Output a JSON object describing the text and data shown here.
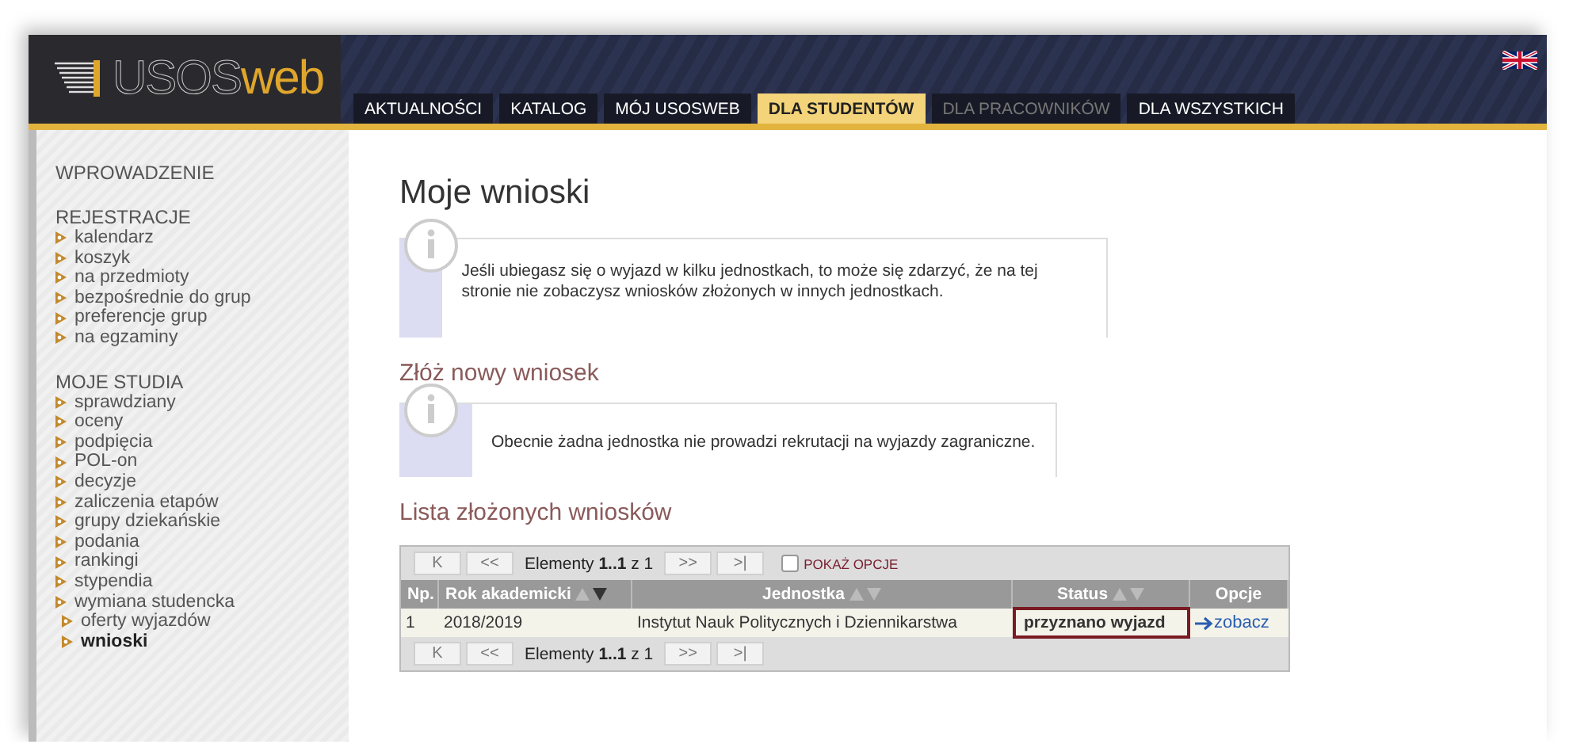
{
  "header": {
    "logo": {
      "part_1": "USOS",
      "part_2": "web"
    },
    "tabs": [
      {
        "label": "AKTUALNOŚCI",
        "selected": false,
        "disabled": false
      },
      {
        "label": "KATALOG",
        "selected": false,
        "disabled": false
      },
      {
        "label": "MÓJ USOSWEB",
        "selected": false,
        "disabled": false
      },
      {
        "label": "DLA STUDENTÓW",
        "selected": true,
        "disabled": false
      },
      {
        "label": "DLA PRACOWNIKÓW",
        "selected": false,
        "disabled": true
      },
      {
        "label": "DLA WSZYSTKICH",
        "selected": false,
        "disabled": false
      }
    ]
  },
  "sidebar": {
    "sections": [
      {
        "title": "WPROWADZENIE"
      },
      {
        "title": "REJESTRACJE",
        "items": [
          {
            "label": "kalendarz",
            "selected": false
          },
          {
            "label": "koszyk",
            "selected": false
          },
          {
            "label": "na przedmioty",
            "selected": false
          },
          {
            "label": "bezpośrednie do grup",
            "selected": false
          },
          {
            "label": "preferencje grup",
            "selected": false
          },
          {
            "label": "na egzaminy",
            "selected": false
          }
        ]
      },
      {
        "title": "MOJE STUDIA",
        "items": [
          {
            "label": "sprawdziany",
            "selected": false
          },
          {
            "label": "oceny",
            "selected": false
          },
          {
            "label": "podpięcia",
            "selected": false
          },
          {
            "label": "POL-on",
            "selected": false
          },
          {
            "label": "decyzje",
            "selected": false
          },
          {
            "label": "zaliczenia etapów",
            "selected": false
          },
          {
            "label": "grupy dziekańskie",
            "selected": false
          },
          {
            "label": "podania",
            "selected": false
          },
          {
            "label": "rankingi",
            "selected": false
          },
          {
            "label": "stypendia",
            "selected": false
          },
          {
            "label": "wymiana studencka",
            "selected": false,
            "children": [
              {
                "label": "oferty wyjazdów",
                "selected": false
              },
              {
                "label": "wnioski",
                "selected": true
              }
            ]
          }
        ]
      }
    ]
  },
  "content": {
    "title": "Moje wnioski",
    "notice_1": "Jeśli ubiegasz się o wyjazd w kilku jednostkach, to może się zdarzyć, że na tej stronie nie zobaczysz wniosków złożonych w innych jednostkach.",
    "section_1": "Złóż nowy wniosek",
    "notice_2": "Obecnie żadna jednostka nie prowadzi rekrutacji na wyjazdy zagraniczne.",
    "section_2": "Lista złożonych wniosków",
    "table": {
      "pager_top": {
        "buttons_before": [
          "K",
          "<<"
        ],
        "info": "Elementy **1..1** z 1",
        "buttons_after": [
          ">>",
          ">|"
        ],
        "show_options": {
          "label": "POKAŻ OPCJE",
          "checked": false
        }
      },
      "columns": [
        {
          "label": "Np."
        },
        {
          "label": "Rok akademicki",
          "sortable": true,
          "sorted": true
        },
        {
          "label": "Jednostka",
          "sortable": true,
          "sorted": false
        },
        {
          "label": "Status",
          "sortable": true,
          "sorted": false
        },
        {
          "label": "Opcje"
        }
      ],
      "rows": [
        {
          "number": "1",
          "year": "2018/2019",
          "unit": "Instytut Nauk Politycznych i Dziennikarstwa",
          "status": "przyznano wyjazd",
          "highlighted": true,
          "action": "zobacz"
        }
      ],
      "pager_bottom": {
        "buttons_before": [
          "K",
          "<<"
        ],
        "info": "Elementy **1..1** z 1",
        "buttons_after": [
          ">>",
          ">|"
        ]
      }
    }
  }
}
